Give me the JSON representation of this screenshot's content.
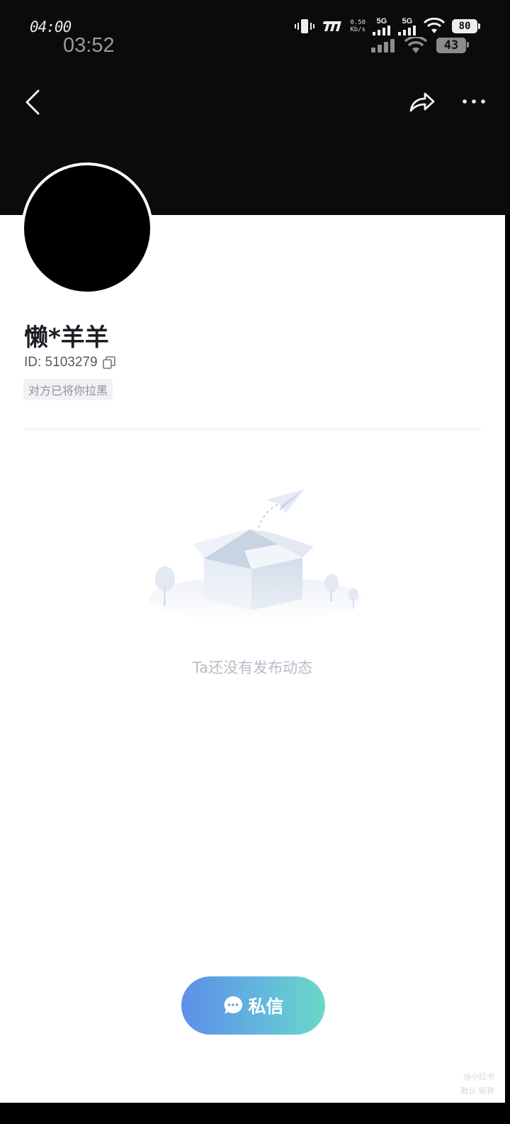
{
  "status_bar_primary": {
    "time": "04:00",
    "net_speed_value": "0.50",
    "net_speed_unit": "Kb/s",
    "signal_1_label": "5G",
    "signal_2_label": "5G",
    "battery_level": "80"
  },
  "status_bar_secondary": {
    "time": "03:52",
    "battery_level": "43"
  },
  "profile": {
    "nickname": "懒*羊羊",
    "id_text": "ID: 5103279",
    "block_badge": "对方已将你拉黑"
  },
  "empty_state": {
    "text": "Ta还没有发布动态"
  },
  "actions": {
    "message_label": "私信"
  },
  "watermark": {
    "line1": "@小红书",
    "line2": "默认 昵称"
  },
  "colors": {
    "header_bg": "#0b0b0c",
    "button_gradient_start": "#5f8fe8",
    "button_gradient_end": "#6bd8c8"
  }
}
